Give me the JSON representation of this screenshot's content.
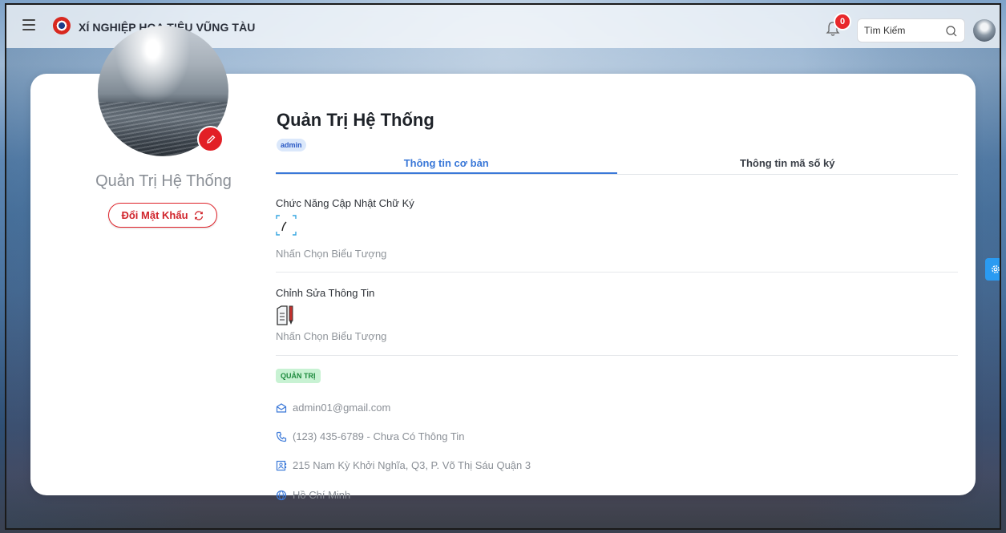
{
  "header": {
    "app_title": "XÍ NGHIỆP HOA TIÊU VŨNG TÀU",
    "notification_count": "0",
    "search_placeholder": "Tìm Kiếm"
  },
  "profile": {
    "side_name": "Quản Trị Hệ Thống",
    "change_password_label": "Đổi Mật Khẩu",
    "name": "Quản Trị Hệ Thống",
    "username_badge": "admin"
  },
  "tabs": [
    {
      "label": "Thông tin cơ bản",
      "active": true
    },
    {
      "label": "Thông tin mã số ký",
      "active": false
    }
  ],
  "sections": {
    "signature": {
      "title": "Chức Năng Cập Nhật Chữ Ký",
      "hint": "Nhấn Chọn Biểu Tượng",
      "icon": "signature-edit-icon"
    },
    "edit_info": {
      "title": "Chỉnh Sửa Thông Tin",
      "hint": "Nhấn Chọn Biểu Tượng",
      "icon": "document-edit-icon"
    }
  },
  "role_tag": "QUẢN TRỊ",
  "contact": {
    "email": "admin01@gmail.com",
    "phone": "(123) 435-6789 - Chưa Có Thông Tin",
    "address": "215 Nam Kỳ Khởi Nghĩa, Q3, P. Võ Thị Sáu Quận 3",
    "city": "Hồ Chí Minh"
  },
  "colors": {
    "accent_blue": "#3a78d8",
    "danger_red": "#e21f26",
    "success_green": "#1d8a3d"
  }
}
